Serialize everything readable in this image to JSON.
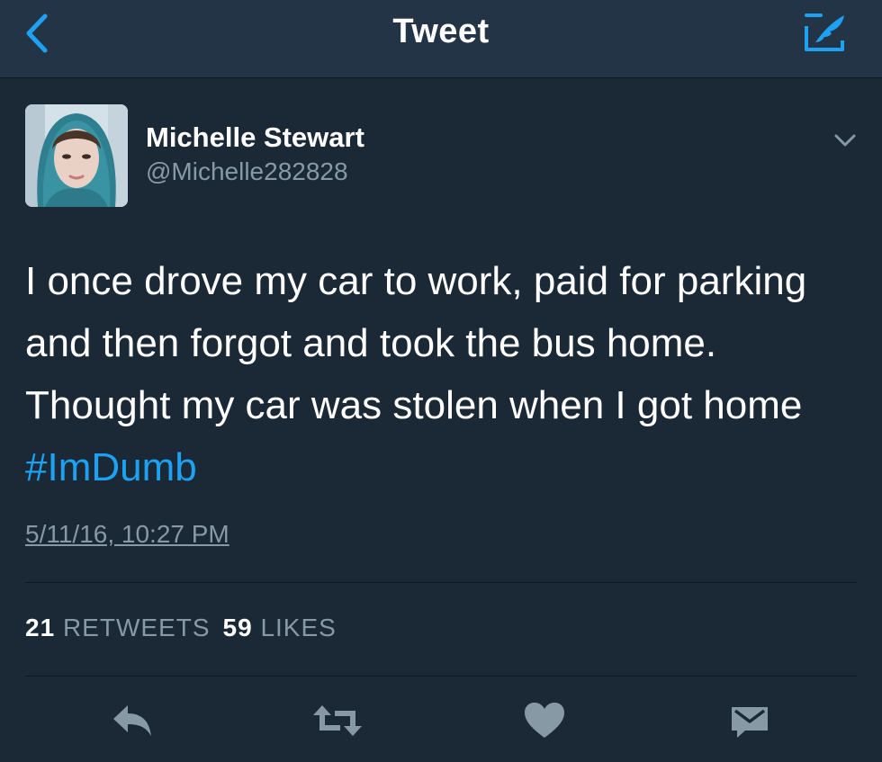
{
  "nav": {
    "title": "Tweet",
    "back_icon": "chevron-left-icon",
    "compose_icon": "compose-feather-icon",
    "accent_color": "#1da1f2"
  },
  "tweet": {
    "author": {
      "name": "Michelle Stewart",
      "handle": "@Michelle282828"
    },
    "text_lines": [
      "I once drove my car to work, paid for parking",
      "and then forgot and took the bus home.",
      "Thought my car was stolen when I got home"
    ],
    "hashtag": "#ImDumb",
    "timestamp": "5/11/16, 10:27 PM",
    "stats": {
      "retweets_count": "21",
      "retweets_label": "RETWEETS",
      "likes_count": "59",
      "likes_label": "LIKES"
    }
  },
  "actions": [
    {
      "name": "reply",
      "icon": "reply-icon"
    },
    {
      "name": "retweet",
      "icon": "retweet-icon"
    },
    {
      "name": "like",
      "icon": "heart-icon"
    },
    {
      "name": "message",
      "icon": "envelope-icon"
    }
  ],
  "colors": {
    "background": "#1b2836",
    "navbar": "#243447",
    "secondary_text": "#8899a6",
    "hashtag": "#1da1f2"
  }
}
